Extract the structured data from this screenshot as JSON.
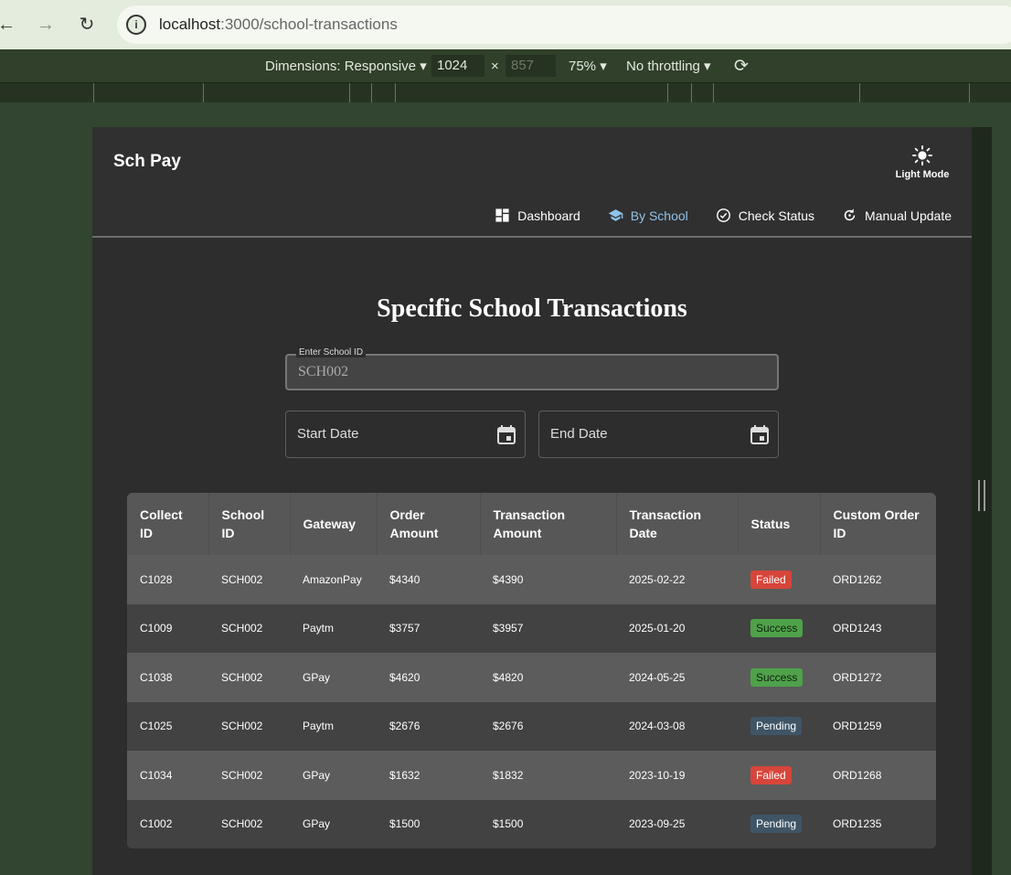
{
  "browser": {
    "url_host": "localhost",
    "url_path": ":3000/school-transactions"
  },
  "devtools": {
    "dimensions_label": "Dimensions: Responsive",
    "width": "1024",
    "height": "857",
    "zoom": "75%",
    "throttling": "No throttling"
  },
  "app": {
    "brand": "Sch Pay",
    "theme_toggle": "Light Mode",
    "nav": [
      {
        "label": "Dashboard",
        "icon": "dashboard-icon"
      },
      {
        "label": "By School",
        "icon": "school-icon",
        "active": true
      },
      {
        "label": "Check Status",
        "icon": "check-circle-icon"
      },
      {
        "label": "Manual Update",
        "icon": "refresh-icon"
      }
    ],
    "accent_color": "#8fc3ea"
  },
  "page": {
    "title": "Specific School Transactions",
    "school_id_label": "Enter School ID",
    "school_id_value": "SCH002",
    "start_date_placeholder": "Start Date",
    "end_date_placeholder": "End Date"
  },
  "table": {
    "headers": [
      "Collect ID",
      "School ID",
      "Gateway",
      "Order Amount",
      "Transaction Amount",
      "Transaction Date",
      "Status",
      "Custom Order ID"
    ],
    "rows": [
      {
        "collect_id": "C1028",
        "school_id": "SCH002",
        "gateway": "AmazonPay",
        "order_amount": "$4340",
        "transaction_amount": "$4390",
        "date": "2025-02-22",
        "status": "Failed",
        "custom_order_id": "ORD1262"
      },
      {
        "collect_id": "C1009",
        "school_id": "SCH002",
        "gateway": "Paytm",
        "order_amount": "$3757",
        "transaction_amount": "$3957",
        "date": "2025-01-20",
        "status": "Success",
        "custom_order_id": "ORD1243"
      },
      {
        "collect_id": "C1038",
        "school_id": "SCH002",
        "gateway": "GPay",
        "order_amount": "$4620",
        "transaction_amount": "$4820",
        "date": "2024-05-25",
        "status": "Success",
        "custom_order_id": "ORD1272"
      },
      {
        "collect_id": "C1025",
        "school_id": "SCH002",
        "gateway": "Paytm",
        "order_amount": "$2676",
        "transaction_amount": "$2676",
        "date": "2024-03-08",
        "status": "Pending",
        "custom_order_id": "ORD1259"
      },
      {
        "collect_id": "C1034",
        "school_id": "SCH002",
        "gateway": "GPay",
        "order_amount": "$1632",
        "transaction_amount": "$1832",
        "date": "2023-10-19",
        "status": "Failed",
        "custom_order_id": "ORD1268"
      },
      {
        "collect_id": "C1002",
        "school_id": "SCH002",
        "gateway": "GPay",
        "order_amount": "$1500",
        "transaction_amount": "$1500",
        "date": "2023-09-25",
        "status": "Pending",
        "custom_order_id": "ORD1235"
      }
    ],
    "status_colors": {
      "Failed": "#d7453b",
      "Success": "#4fa14a",
      "Pending": "#3f5566"
    }
  }
}
